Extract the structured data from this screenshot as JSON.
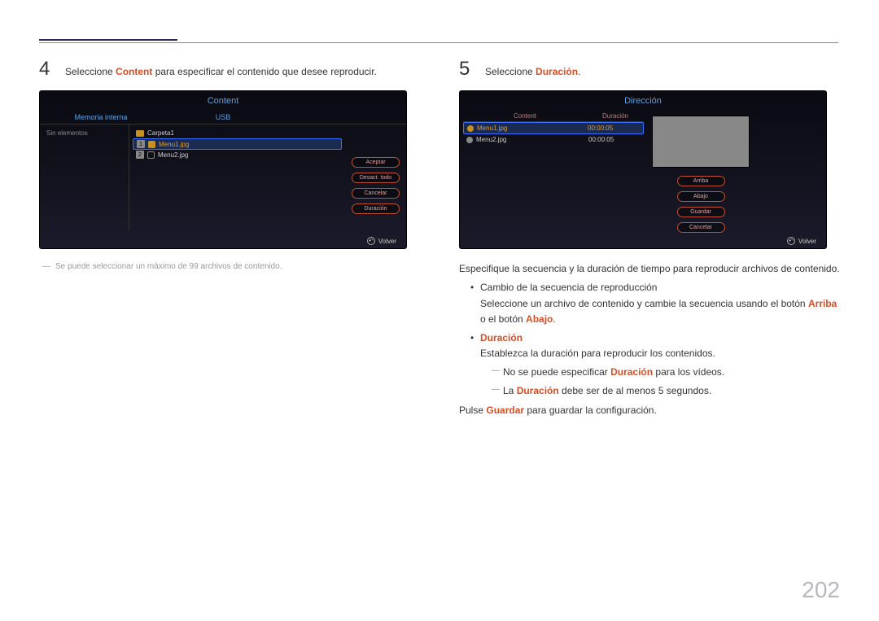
{
  "page_number": "202",
  "left": {
    "step_num": "4",
    "step_prefix": "Seleccione ",
    "step_accent": "Content",
    "step_suffix": " para especificar el contenido que desee reproducir.",
    "note_dash": "―",
    "note": "Se puede seleccionar un máximo de 99 archivos de contenido.",
    "ss": {
      "title": "Content",
      "tab_internal": "Memoria interna",
      "tab_usb": "USB",
      "empty": "Sin elementos",
      "folder": "Carpeta1",
      "row1_num": "1",
      "row1_name": "Menu1.jpg",
      "row2_num": "2",
      "row2_name": "Menu2.jpg",
      "btn_accept": "Aceptar",
      "btn_unselect": "Desact. todo",
      "btn_cancel": "Cancelar",
      "btn_duration": "Duración",
      "footer": "Volver"
    }
  },
  "right": {
    "step_num": "5",
    "step_prefix": "Seleccione ",
    "step_accent": "Duración",
    "step_suffix": ".",
    "ss": {
      "title": "Dirección",
      "col_content": "Content",
      "col_duration": "Duración",
      "row1_name": "Menu1.jpg",
      "row1_dur": "00:00:05",
      "row2_name": "Menu2.jpg",
      "row2_dur": "00:00:05",
      "btn_up": "Arriba",
      "btn_down": "Abajo",
      "btn_save": "Guardar",
      "btn_cancel": "Cancelar",
      "footer": "Volver"
    },
    "p1": "Especifique la secuencia y la duración de tiempo para reproducir archivos de contenido.",
    "b1_title": "Cambio de la secuencia de reproducción",
    "b1_line_a": "Seleccione un archivo de contenido y cambie la secuencia usando el botón ",
    "b1_arriba": "Arriba",
    "b1_line_b": " o el botón ",
    "b1_abajo": "Abajo",
    "b1_line_c": ".",
    "b2_title": "Duración",
    "b2_line": "Establezca la duración para reproducir los contenidos.",
    "b2_sub1_a": "No se puede especificar ",
    "b2_sub1_accent": "Duración",
    "b2_sub1_b": " para los vídeos.",
    "b2_sub2_a": "La ",
    "b2_sub2_accent": "Duración",
    "b2_sub2_b": " debe ser de al menos 5 segundos.",
    "p2_a": "Pulse ",
    "p2_accent": "Guardar",
    "p2_b": " para guardar la configuración."
  }
}
